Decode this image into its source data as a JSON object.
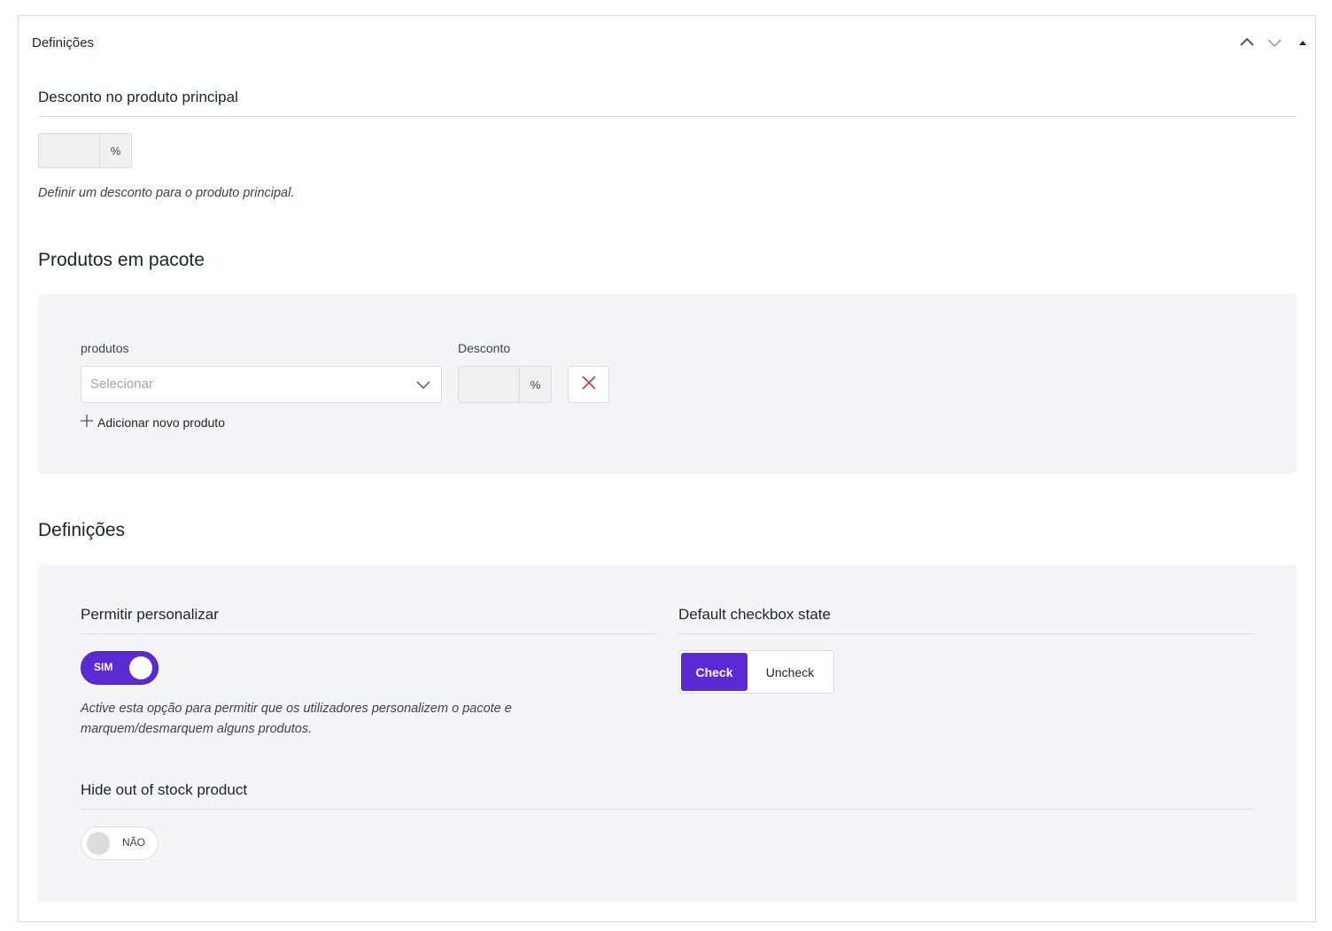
{
  "panel": {
    "title": "Definições"
  },
  "main_discount": {
    "label": "Desconto no produto principal",
    "suffix": "%",
    "help": "Definir um desconto para o produto principal."
  },
  "bundle": {
    "heading": "Produtos em pacote",
    "products_label": "produtos",
    "discount_label": "Desconto",
    "select_placeholder": "Selecionar",
    "suffix": "%",
    "add_label": "Adicionar novo produto"
  },
  "settings": {
    "heading": "Definições",
    "allow_customize": {
      "label": "Permitir personalizar",
      "toggle_label": "SIM",
      "enabled": true,
      "help_line1": "Active esta opção para permitir que os utilizadores personalizem o pacote e",
      "help_line2": "marquem/desmarquem alguns produtos."
    },
    "default_checkbox": {
      "label": "Default checkbox state",
      "options": [
        "Check",
        "Uncheck"
      ],
      "selected": "Check"
    },
    "hide_out_of_stock": {
      "label": "Hide out of stock product",
      "toggle_label": "NÃO",
      "enabled": false
    }
  },
  "colors": {
    "accent": "#5b2ad4",
    "remove": "#d63638"
  }
}
